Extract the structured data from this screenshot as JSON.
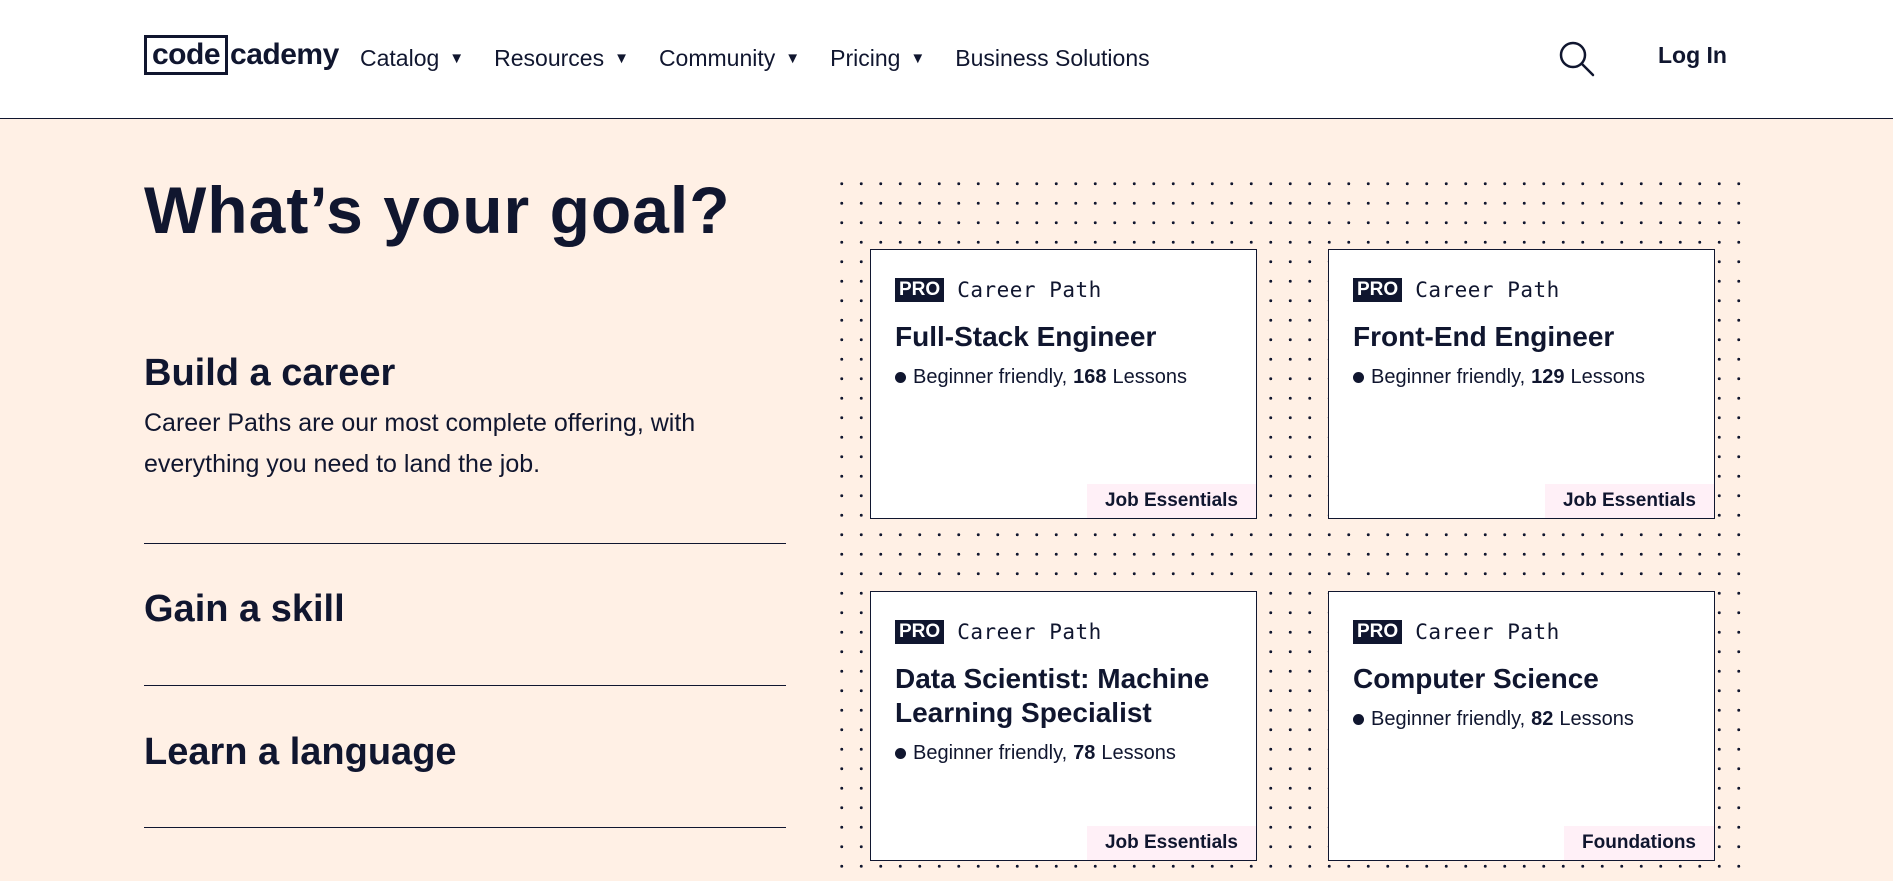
{
  "header": {
    "logo": {
      "boxed": "code",
      "rest": "cademy"
    },
    "nav": [
      {
        "label": "Catalog",
        "caret": "▼"
      },
      {
        "label": "Resources",
        "caret": "▼"
      },
      {
        "label": "Community",
        "caret": "▼"
      },
      {
        "label": "Pricing",
        "caret": "▼"
      },
      {
        "label": "Business Solutions",
        "caret": ""
      }
    ],
    "search_icon": "search-icon",
    "login_label": "Log In"
  },
  "main": {
    "title": "What’s your goal?",
    "goals": [
      {
        "heading": "Build a career",
        "description": "Career Paths are our most complete offering, with everything you need to land the job."
      },
      {
        "heading": "Gain a skill",
        "description": ""
      },
      {
        "heading": "Learn a language",
        "description": ""
      }
    ],
    "cards": [
      {
        "pro": "PRO",
        "type": "Career Path",
        "title": "Full-Stack Engineer",
        "level": "Beginner friendly,",
        "lessons_count": "168",
        "lessons_label": "Lessons",
        "tag": "Job Essentials"
      },
      {
        "pro": "PRO",
        "type": "Career Path",
        "title": "Front-End Engineer",
        "level": "Beginner friendly,",
        "lessons_count": "129",
        "lessons_label": "Lessons",
        "tag": "Job Essentials"
      },
      {
        "pro": "PRO",
        "type": "Career Path",
        "title": "Data Scientist: Machine Learning Specialist",
        "level": "Beginner friendly,",
        "lessons_count": "78",
        "lessons_label": "Lessons",
        "tag": "Job Essentials"
      },
      {
        "pro": "PRO",
        "type": "Career Path",
        "title": "Computer Science",
        "level": "Beginner friendly,",
        "lessons_count": "82",
        "lessons_label": "Lessons",
        "tag": "Foundations"
      }
    ]
  },
  "colors": {
    "navy": "#10162f",
    "background": "#fff0e5",
    "tag_bg": "#fff0f7"
  }
}
